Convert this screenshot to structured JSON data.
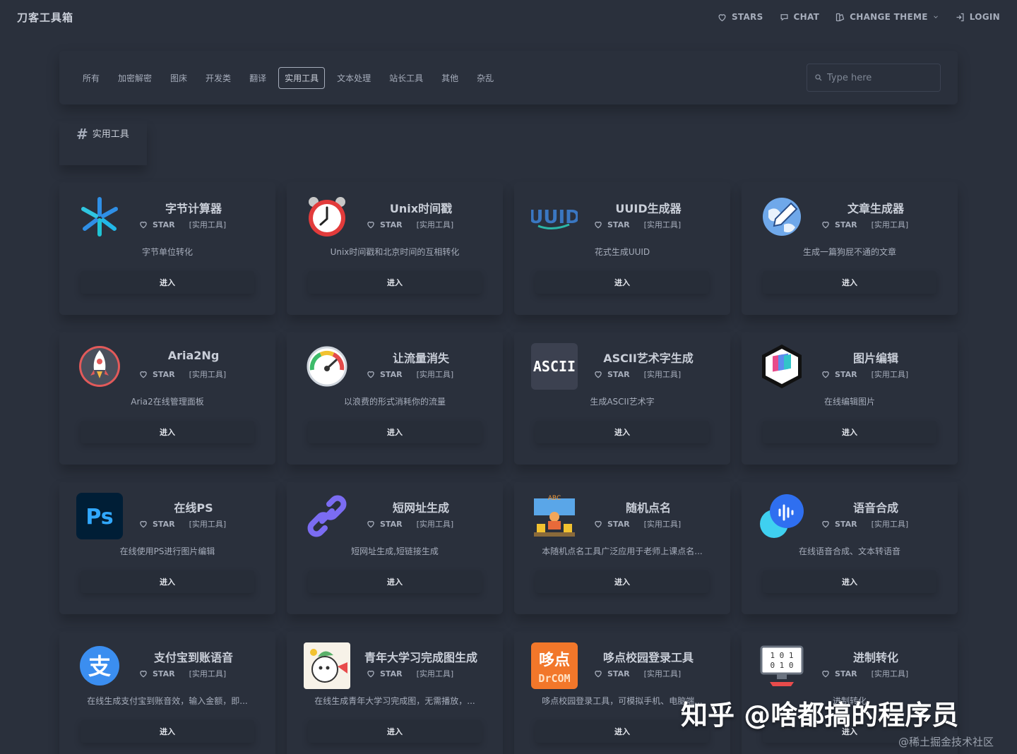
{
  "header": {
    "brand": "刀客工具箱",
    "nav": {
      "stars": "STARS",
      "chat": "CHAT",
      "theme": "CHANGE THEME",
      "login": "LOGIN"
    }
  },
  "categories": [
    "所有",
    "加密解密",
    "图床",
    "开发类",
    "翻译",
    "实用工具",
    "文本处理",
    "站长工具",
    "其他",
    "杂乱"
  ],
  "active_category": "实用工具",
  "search": {
    "placeholder": "Type here"
  },
  "section": {
    "title": "实用工具"
  },
  "card_common": {
    "star": "STAR",
    "tag": "[实用工具]",
    "enter": "进入"
  },
  "cards": [
    {
      "name": "字节计算器",
      "desc": "字节单位转化",
      "icon": "asterisk-icon"
    },
    {
      "name": "Unix时间戳",
      "desc": "Unix时间戳和北京时间的互相转化",
      "icon": "alarm-clock-icon"
    },
    {
      "name": "UUID生成器",
      "desc": "花式生成UUID",
      "icon": "uuid-logo-icon"
    },
    {
      "name": "文章生成器",
      "desc": "生成一篇狗屁不通的文章",
      "icon": "globe-pencil-icon"
    },
    {
      "name": "Aria2Ng",
      "desc": "Aria2在线管理面板",
      "icon": "rocket-icon"
    },
    {
      "name": "让流量消失",
      "desc": "以浪费的形式消耗你的流量",
      "icon": "speedometer-icon"
    },
    {
      "name": "ASCII艺术字生成",
      "desc": "生成ASCII艺术字",
      "icon": "ascii-logo-icon"
    },
    {
      "name": "图片编辑",
      "desc": "在线编辑图片",
      "icon": "image-editor-logo-icon"
    },
    {
      "name": "在线PS",
      "desc": "在线使用PS进行图片编辑",
      "icon": "photoshop-logo-icon"
    },
    {
      "name": "短网址生成",
      "desc": "短网址生成,短链接生成",
      "icon": "link-icon"
    },
    {
      "name": "随机点名",
      "desc": "本随机点名工具广泛应用于老师上课点名...",
      "icon": "classroom-icon"
    },
    {
      "name": "语音合成",
      "desc": "在线语音合成、文本转语音",
      "icon": "voice-wave-icon"
    },
    {
      "name": "支付宝到账语音",
      "desc": "在线生成支付宝到账音效，输入金额，即...",
      "icon": "alipay-logo-icon"
    },
    {
      "name": "青年大学习完成图生成",
      "desc": "在线生成青年大学习完成图，无需播放，...",
      "icon": "cartoon-character-icon"
    },
    {
      "name": "哆点校园登录工具",
      "desc": "哆点校园登录工具，可模拟手机、电脑端...",
      "icon": "drcom-logo-icon"
    },
    {
      "name": "进制转化",
      "desc": "进制转化",
      "icon": "binary-monitor-icon"
    }
  ],
  "watermark": {
    "main": "知乎 @啥都搞的程序员",
    "sub": "@稀土掘金技术社区"
  },
  "colors": {
    "background": "#2a303c",
    "text": "#a6adbb",
    "heading": "#c9ced8"
  }
}
